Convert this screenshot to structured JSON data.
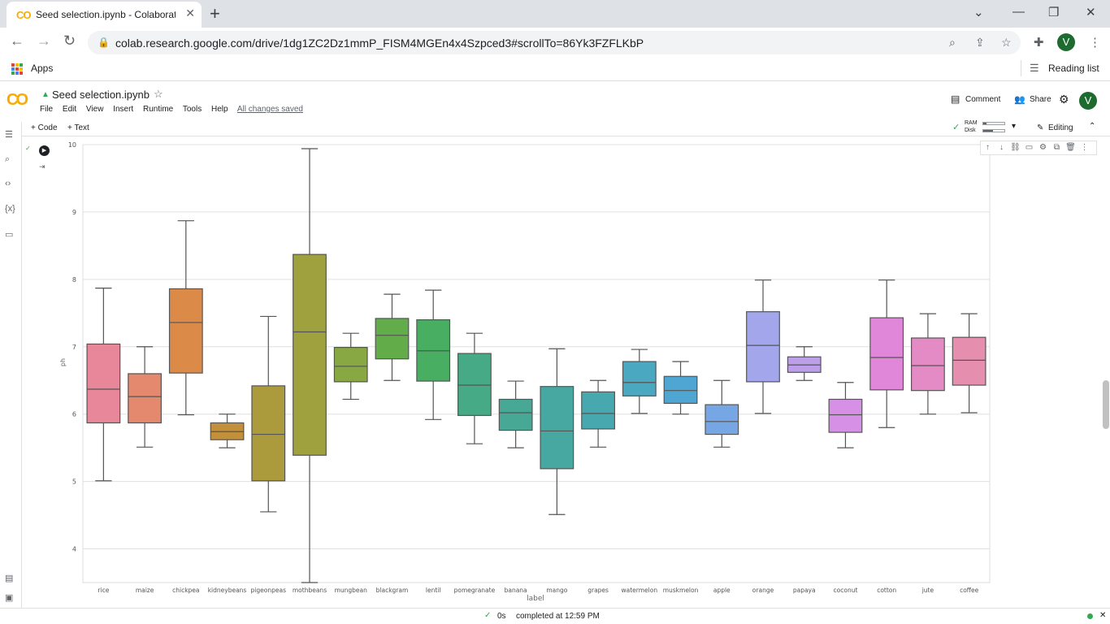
{
  "browser": {
    "tab_title": "Seed selection.ipynb - Colaborat",
    "url": "colab.research.google.com/drive/1dg1ZC2Dz1mmP_FISM4MGEn4x4Szpced3#scrollTo=86Yk3FZFLKbP",
    "profile_initial": "V",
    "bookmarks_apps": "Apps",
    "reading_list": "Reading list"
  },
  "colab": {
    "notebook_title": "Seed selection.ipynb",
    "menus": [
      "File",
      "Edit",
      "View",
      "Insert",
      "Runtime",
      "Tools",
      "Help"
    ],
    "save_status": "All changes saved",
    "comment": "Comment",
    "share": "Share",
    "user_initial": "V",
    "add_code": "+ Code",
    "add_text": "+ Text",
    "ram_label": "RAM",
    "disk_label": "Disk",
    "editing": "Editing",
    "status_time": "0s",
    "status_text": "completed at 12:59 PM"
  },
  "chart_data": {
    "type": "box",
    "xlabel": "label",
    "ylabel": "ph",
    "ylim": [
      3.5,
      10.0
    ],
    "yticks": [
      4,
      5,
      6,
      7,
      8,
      9,
      10
    ],
    "grid": "horizontal",
    "categories": [
      "rice",
      "maize",
      "chickpea",
      "kidneybeans",
      "pigeonpeas",
      "mothbeans",
      "mungbean",
      "blackgram",
      "lentil",
      "pomegranate",
      "banana",
      "mango",
      "grapes",
      "watermelon",
      "muskmelon",
      "apple",
      "orange",
      "papaya",
      "coconut",
      "cotton",
      "jute",
      "coffee"
    ],
    "boxes": [
      {
        "whisker_low": 5.01,
        "q1": 5.87,
        "median": 6.37,
        "q3": 7.04,
        "whisker_high": 7.87,
        "color": "#e8879a"
      },
      {
        "whisker_low": 5.51,
        "q1": 5.87,
        "median": 6.26,
        "q3": 6.6,
        "whisker_high": 7.0,
        "color": "#e4896d"
      },
      {
        "whisker_low": 5.99,
        "q1": 6.61,
        "median": 7.36,
        "q3": 7.86,
        "whisker_high": 8.87,
        "color": "#dc8a48"
      },
      {
        "whisker_low": 5.5,
        "q1": 5.62,
        "median": 5.74,
        "q3": 5.87,
        "whisker_high": 6.0,
        "color": "#c28f3a"
      },
      {
        "whisker_low": 4.55,
        "q1": 5.01,
        "median": 5.7,
        "q3": 6.42,
        "whisker_high": 7.45,
        "color": "#ab9b3c"
      },
      {
        "whisker_low": 3.5,
        "q1": 5.39,
        "median": 7.22,
        "q3": 8.37,
        "whisker_high": 9.94,
        "color": "#9fa13f"
      },
      {
        "whisker_low": 6.22,
        "q1": 6.48,
        "median": 6.71,
        "q3": 6.99,
        "whisker_high": 7.2,
        "color": "#88a844"
      },
      {
        "whisker_low": 6.5,
        "q1": 6.82,
        "median": 7.17,
        "q3": 7.42,
        "whisker_high": 7.78,
        "color": "#62ad4a"
      },
      {
        "whisker_low": 5.92,
        "q1": 6.49,
        "median": 6.94,
        "q3": 7.4,
        "whisker_high": 7.84,
        "color": "#48ae62"
      },
      {
        "whisker_low": 5.56,
        "q1": 5.98,
        "median": 6.43,
        "q3": 6.9,
        "whisker_high": 7.2,
        "color": "#47aa87"
      },
      {
        "whisker_low": 5.5,
        "q1": 5.76,
        "median": 6.02,
        "q3": 6.22,
        "whisker_high": 6.49,
        "color": "#47a896"
      },
      {
        "whisker_low": 4.51,
        "q1": 5.19,
        "median": 5.75,
        "q3": 6.41,
        "whisker_high": 6.97,
        "color": "#47a8a2"
      },
      {
        "whisker_low": 5.51,
        "q1": 5.78,
        "median": 6.01,
        "q3": 6.33,
        "whisker_high": 6.5,
        "color": "#48a8b0"
      },
      {
        "whisker_low": 6.01,
        "q1": 6.27,
        "median": 6.47,
        "q3": 6.78,
        "whisker_high": 6.96,
        "color": "#4aa8c0"
      },
      {
        "whisker_low": 6.0,
        "q1": 6.16,
        "median": 6.35,
        "q3": 6.56,
        "whisker_high": 6.78,
        "color": "#4fa6d2"
      },
      {
        "whisker_low": 5.51,
        "q1": 5.7,
        "median": 5.89,
        "q3": 6.14,
        "whisker_high": 6.5,
        "color": "#76a6e4"
      },
      {
        "whisker_low": 6.01,
        "q1": 6.48,
        "median": 7.02,
        "q3": 7.52,
        "whisker_high": 7.99,
        "color": "#a3a6ea"
      },
      {
        "whisker_low": 6.5,
        "q1": 6.62,
        "median": 6.73,
        "q3": 6.85,
        "whisker_high": 7.0,
        "color": "#bd9ee8"
      },
      {
        "whisker_low": 5.5,
        "q1": 5.73,
        "median": 5.99,
        "q3": 6.22,
        "whisker_high": 6.47,
        "color": "#d691e6"
      },
      {
        "whisker_low": 5.8,
        "q1": 6.36,
        "median": 6.84,
        "q3": 7.43,
        "whisker_high": 7.99,
        "color": "#e187da"
      },
      {
        "whisker_low": 6.0,
        "q1": 6.35,
        "median": 6.72,
        "q3": 7.13,
        "whisker_high": 7.49,
        "color": "#e48bc6"
      },
      {
        "whisker_low": 6.02,
        "q1": 6.43,
        "median": 6.8,
        "q3": 7.14,
        "whisker_high": 7.49,
        "color": "#e68eae"
      }
    ]
  }
}
